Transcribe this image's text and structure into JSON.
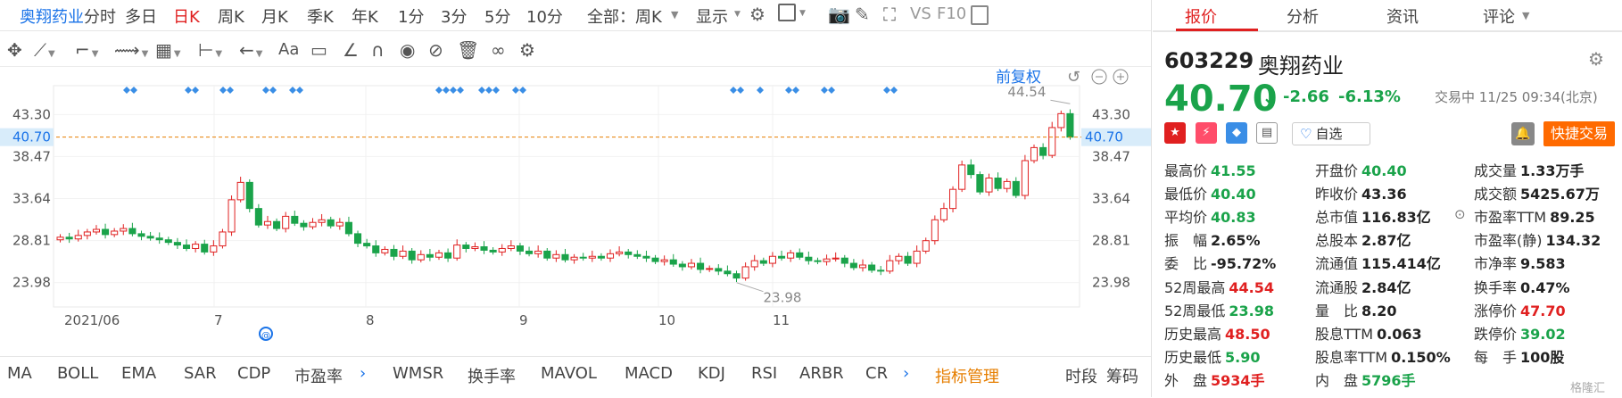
{
  "top_bar": {
    "stock_tab": "奥翔药业",
    "periods": [
      "分时",
      "多日",
      "日K",
      "周K",
      "月K",
      "季K",
      "年K",
      "1分",
      "3分",
      "5分",
      "10分",
      "全部：周K"
    ],
    "active_period": "日K",
    "display_label": "显示",
    "vs_label": "VS",
    "f10_label": "F10"
  },
  "right_tabs": [
    "报价",
    "分析",
    "资讯",
    "评论"
  ],
  "chart": {
    "adjust_label": "前复权",
    "y_ticks": [
      "43.30",
      "38.47",
      "33.64",
      "28.81",
      "23.98"
    ],
    "current_price_label": "40.70",
    "x_labels": [
      "2021/06",
      "7",
      "8",
      "9",
      "10",
      "11"
    ],
    "high_marker": "44.54",
    "low_marker": "23.98"
  },
  "indicators": [
    "MA",
    "BOLL",
    "EMA",
    "SAR",
    "CDP",
    "市盈率",
    "WMSR",
    "换手率",
    "MAVOL",
    "MACD",
    "KDJ",
    "RSI",
    "ARBR",
    "CR"
  ],
  "indicator_manage": "指标管理",
  "bottom_right": {
    "time_section": "时段",
    "chips": "筹码"
  },
  "quote": {
    "code": "603229",
    "name": "奥翔药业",
    "price": "40.70",
    "change": "-2.66",
    "change_pct": "-6.13%",
    "status": "交易中 11/25 09:34(北京)",
    "watch_label": "自选",
    "quick_trade": "快捷交易",
    "col1": [
      {
        "label": "最高价",
        "value": "41.55",
        "c": "g"
      },
      {
        "label": "最低价",
        "value": "40.40",
        "c": "g"
      },
      {
        "label": "平均价",
        "value": "40.83",
        "c": "g"
      },
      {
        "label": "振　幅",
        "value": "2.65%",
        "c": "k"
      },
      {
        "label": "委　比",
        "value": "-95.72%",
        "c": "k"
      },
      {
        "label": "52周最高",
        "value": "44.54",
        "c": "r"
      },
      {
        "label": "52周最低",
        "value": "23.98",
        "c": "g"
      },
      {
        "label": "历史最高",
        "value": "48.50",
        "c": "r"
      },
      {
        "label": "历史最低",
        "value": "5.90",
        "c": "g"
      },
      {
        "label": "外　盘",
        "value": "5934手",
        "c": "r"
      }
    ],
    "col2": [
      {
        "label": "开盘价",
        "value": "40.40",
        "c": "g"
      },
      {
        "label": "昨收价",
        "value": "43.36",
        "c": "k"
      },
      {
        "label": "总市值",
        "value": "116.83亿",
        "c": "k"
      },
      {
        "label": "总股本",
        "value": "2.87亿",
        "c": "k"
      },
      {
        "label": "流通值",
        "value": "115.414亿",
        "c": "k"
      },
      {
        "label": "流通股",
        "value": "2.84亿",
        "c": "k"
      },
      {
        "label": "量　比",
        "value": "8.20",
        "c": "k"
      },
      {
        "label": "股息TTM",
        "value": "0.063",
        "c": "k"
      },
      {
        "label": "股息率TTM",
        "value": "0.150%",
        "c": "k"
      },
      {
        "label": "内　盘",
        "value": "5796手",
        "c": "g"
      }
    ],
    "col3": [
      {
        "label": "成交量",
        "value": "1.33万手",
        "c": "k"
      },
      {
        "label": "成交额",
        "value": "5425.67万",
        "c": "k"
      },
      {
        "label": "市盈率TTM",
        "value": "89.25",
        "c": "k"
      },
      {
        "label": "市盈率(静)",
        "value": "134.32",
        "c": "k"
      },
      {
        "label": "市净率",
        "value": "9.583",
        "c": "k"
      },
      {
        "label": "换手率",
        "value": "0.47%",
        "c": "k"
      },
      {
        "label": "涨停价",
        "value": "47.70",
        "c": "r"
      },
      {
        "label": "跌停价",
        "value": "39.02",
        "c": "g"
      },
      {
        "label": "每　手",
        "value": "100股",
        "c": "k"
      }
    ]
  },
  "watermark": "格隆汇",
  "chart_data": {
    "type": "candlestick",
    "y_range": [
      22,
      46
    ],
    "closes": [
      29.2,
      29.0,
      29.4,
      29.8,
      30.1,
      29.5,
      29.9,
      30.2,
      29.6,
      29.3,
      29.1,
      28.9,
      28.6,
      28.3,
      27.9,
      28.4,
      27.5,
      28.2,
      29.8,
      33.5,
      35.5,
      32.5,
      30.6,
      31.0,
      30.2,
      31.6,
      30.8,
      30.4,
      30.9,
      31.2,
      30.5,
      30.9,
      29.6,
      28.5,
      28.2,
      27.4,
      27.8,
      27.0,
      27.6,
      26.6,
      27.2,
      26.9,
      27.4,
      26.8,
      28.3,
      27.9,
      28.1,
      27.7,
      27.5,
      27.9,
      28.2,
      27.6,
      27.3,
      27.6,
      26.8,
      27.2,
      26.6,
      26.9,
      26.8,
      27.0,
      26.8,
      27.3,
      27.5,
      27.2,
      27.0,
      26.8,
      26.4,
      26.6,
      26.1,
      25.8,
      26.2,
      25.5,
      25.6,
      25.3,
      25.0,
      24.5,
      25.8,
      26.5,
      26.2,
      27.0,
      26.8,
      27.4,
      26.9,
      26.5,
      26.4,
      26.7,
      26.8,
      26.2,
      25.7,
      26.0,
      25.4,
      25.3,
      26.5,
      27.0,
      26.2,
      27.6,
      28.8,
      31.2,
      32.5,
      34.7,
      37.5,
      36.4,
      34.4,
      36.0,
      34.8,
      35.6,
      34.0,
      38.0,
      39.5,
      38.6,
      41.8,
      43.4,
      40.7
    ],
    "high": 44.54,
    "low": 23.98,
    "last_close": 40.7
  }
}
